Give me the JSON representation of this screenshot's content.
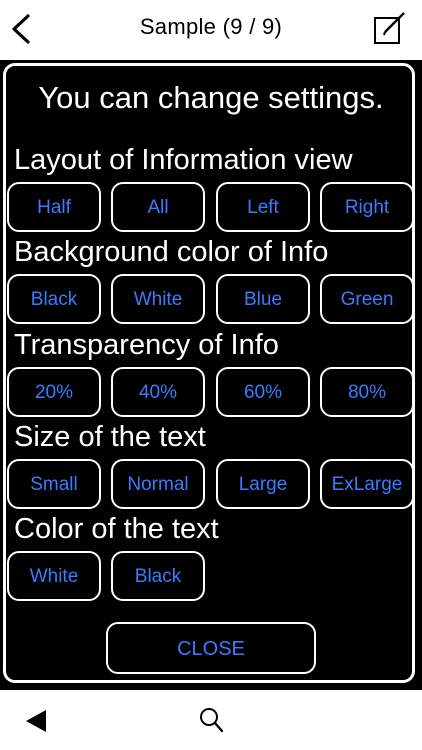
{
  "nav": {
    "title": "Sample (9 / 9)",
    "back_icon": "chevron-left-icon",
    "edit_icon": "compose-icon"
  },
  "panel": {
    "headline": "You can change settings.",
    "sections": [
      {
        "label": "Layout of Information view",
        "options": [
          "Half",
          "All",
          "Left",
          "Right"
        ]
      },
      {
        "label": "Background color of Info",
        "options": [
          "Black",
          "White",
          "Blue",
          "Green"
        ]
      },
      {
        "label": "Transparency of Info",
        "options": [
          "20%",
          "40%",
          "60%",
          "80%"
        ]
      },
      {
        "label": "Size of the text",
        "options": [
          "Small",
          "Normal",
          "Large",
          "ExLarge"
        ]
      },
      {
        "label": "Color of the text",
        "options": [
          "White",
          "Black"
        ]
      }
    ],
    "close_label": "CLOSE"
  },
  "bottom": {
    "prev_icon": "triangle-left-icon",
    "search_icon": "search-icon"
  },
  "colors": {
    "accent": "#3a7bff",
    "panel_bg": "#000000",
    "border": "#ffffff"
  }
}
